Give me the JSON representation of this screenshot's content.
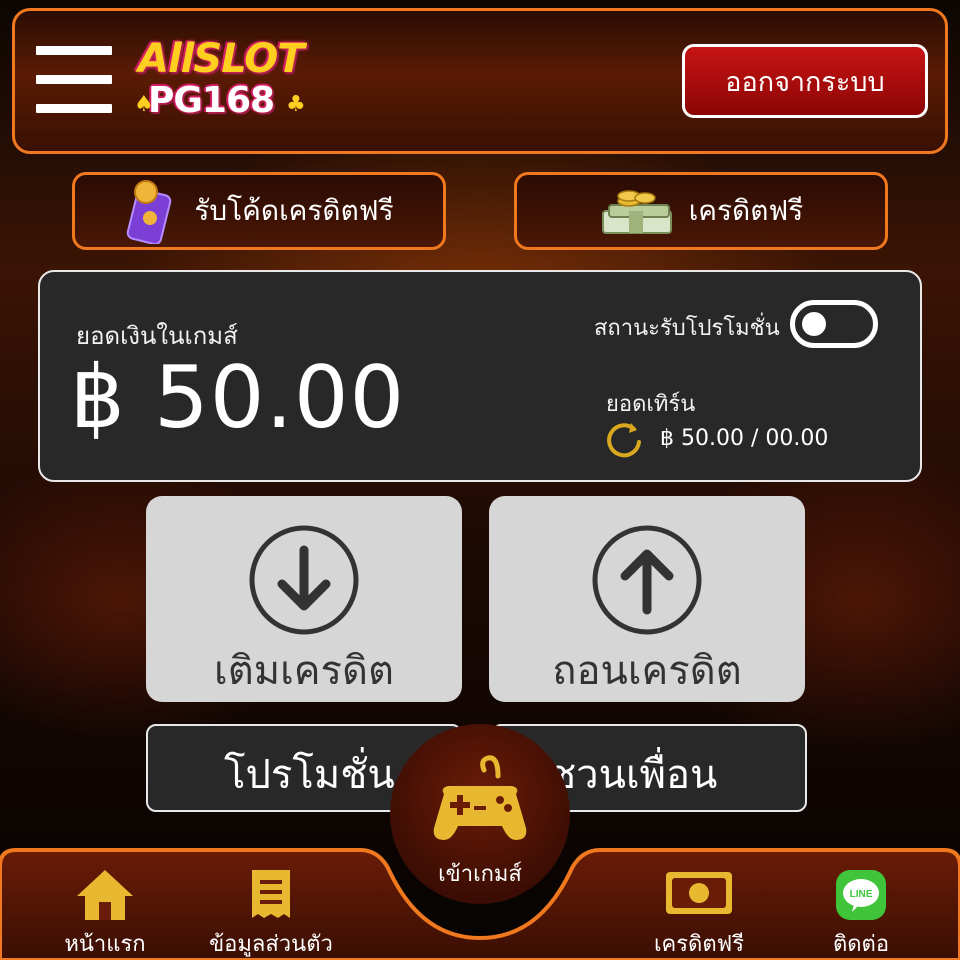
{
  "header": {
    "logo_line1": "AllSLOT",
    "logo_line2": "PG168",
    "logout_label": "ออกจากระบบ"
  },
  "promos": {
    "free_code_label": "รับโค้ดเครดิตฟรี",
    "free_credit_label": "เครดิตฟรี"
  },
  "balance": {
    "label": "ยอดเงินในเกมส์",
    "amount": "฿ 50.00",
    "promo_status_label": "สถานะรับโปรโมชั่น",
    "promo_toggle_on": false,
    "turnover_label": "ยอดเทิร์น",
    "turnover_value": "฿ 50.00 / 00.00"
  },
  "actions": {
    "deposit_label": "เติมเครดิต",
    "withdraw_label": "ถอนเครดิต",
    "promotion_label": "โปรโมชั่น",
    "invite_label": "ชวนเพื่อน"
  },
  "nav": {
    "home": "หน้าแรก",
    "profile": "ข้อมูลส่วนตัว",
    "play": "เข้าเกมส์",
    "free_credit": "เครดิตฟรี",
    "contact": "ติดต่อ"
  },
  "colors": {
    "accent_orange": "#f0781e",
    "logout_red": "#c71414",
    "gold": "#e8b830",
    "line_green": "#3fc43a"
  },
  "icons": [
    "menu-icon",
    "phone-coin-icon",
    "money-stack-icon",
    "refresh-icon",
    "arrow-down-circle-icon",
    "arrow-up-circle-icon",
    "gamepad-icon",
    "home-icon",
    "receipt-icon",
    "banknote-icon",
    "line-chat-icon"
  ]
}
